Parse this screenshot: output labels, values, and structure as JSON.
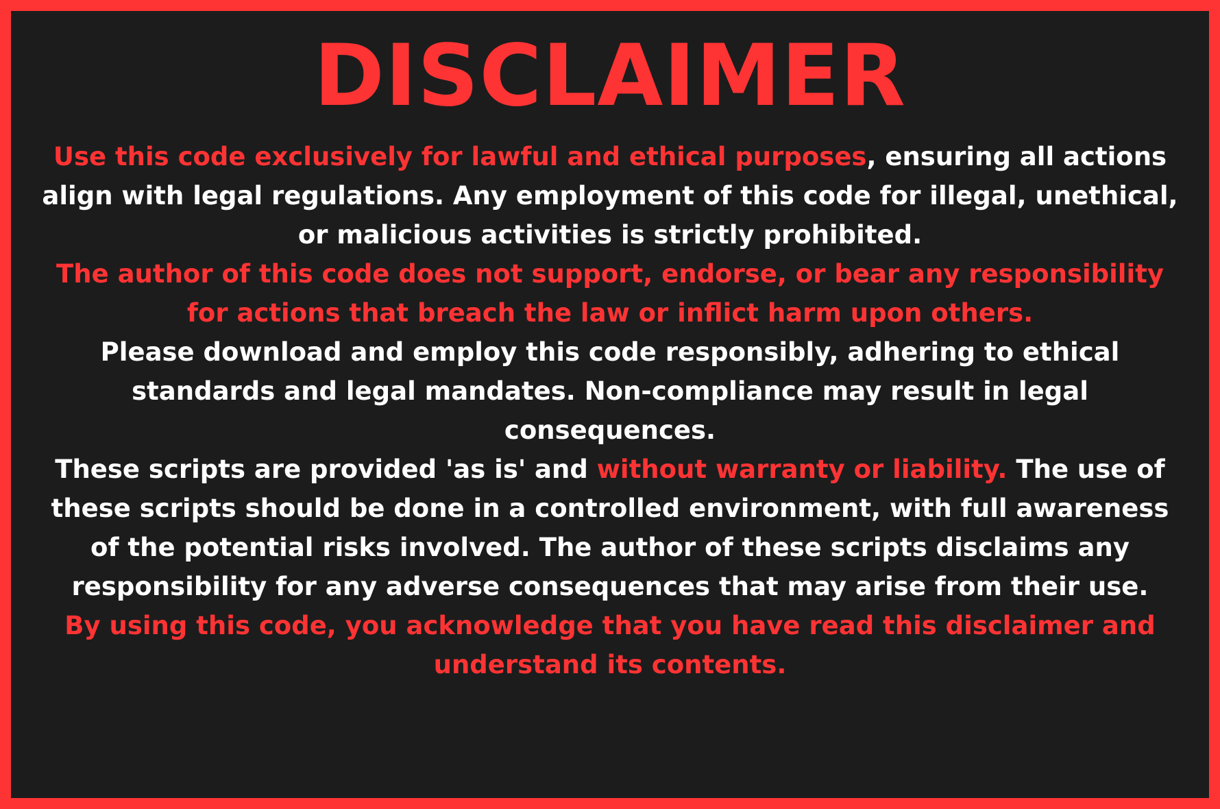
{
  "colors": {
    "accent": "#fe3334",
    "background": "#1c1c1c",
    "text": "#ffffff"
  },
  "title": "DISCLAIMER",
  "paragraphs": {
    "p1": {
      "red": "Use this code exclusively for lawful and ethical purposes",
      "white": ", ensuring all actions align with legal regulations. Any employment of this code for illegal, unethical, or malicious activities is strictly prohibited."
    },
    "p2": {
      "red": "The author of this code does not support, endorse, or bear any responsibility for actions that breach the law or inflict harm upon others."
    },
    "p3": {
      "white": "Please download and employ this code responsibly, adhering to ethical standards and legal mandates. Non-compliance may result in legal consequences."
    },
    "p4": {
      "white_start": "These scripts are provided 'as is' and ",
      "red": "without warranty or liability.",
      "white_end": " The use of these scripts should be done in a controlled environment, with full awareness of the potential risks involved. The author of these scripts disclaims any responsibility for any adverse consequences that may arise from their use."
    },
    "p5": {
      "red": "By using this code, you acknowledge that you have read this disclaimer and understand its contents."
    }
  }
}
